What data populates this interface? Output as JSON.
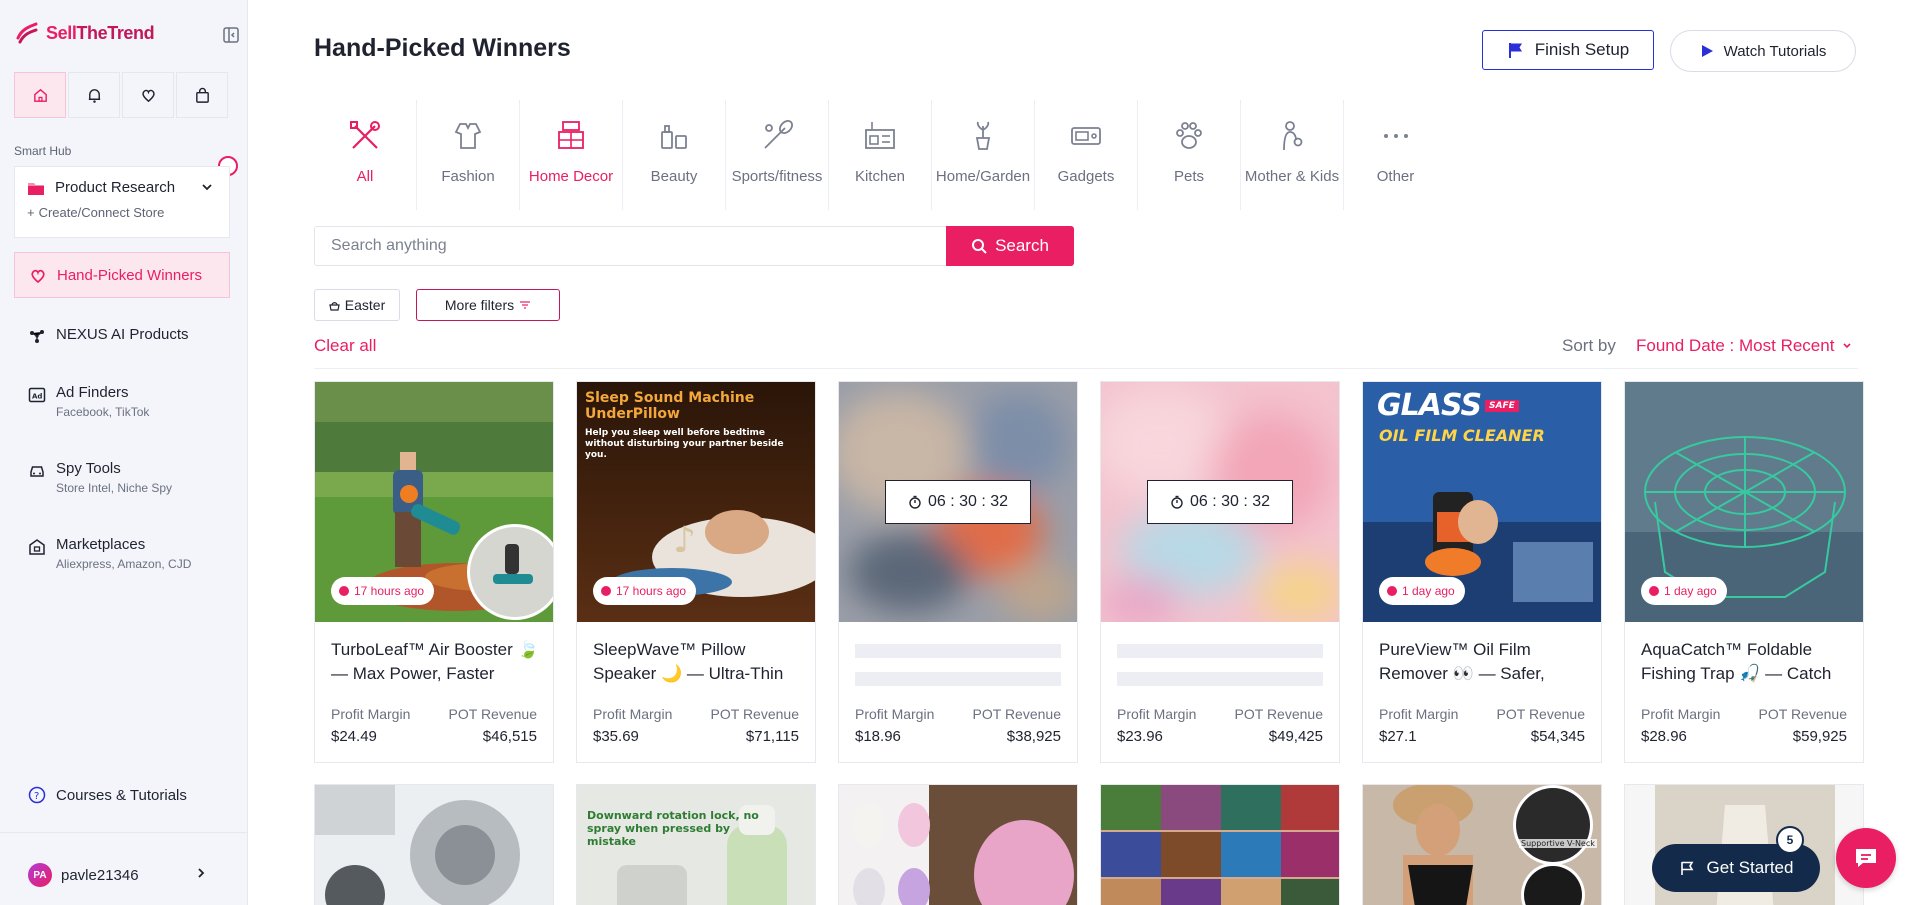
{
  "brand": {
    "name_part1": "Sell",
    "name_part2": "TheTrend",
    "accent": "#e91e63"
  },
  "sidebar": {
    "quick_icons": [
      "home-icon",
      "bell-icon",
      "heart-icon",
      "bag-icon"
    ],
    "smart_hub_label": "Smart Hub",
    "research": {
      "label": "Product Research",
      "create_label": "Create/Connect Store"
    },
    "items": [
      {
        "label": "Hand-Picked Winners",
        "sub": "",
        "icon": "heart-hand-icon",
        "active": true
      },
      {
        "label": "NEXUS AI Products",
        "sub": "",
        "icon": "nodes-icon"
      },
      {
        "label": "Ad Finders",
        "sub": "Facebook, TikTok",
        "icon": "ad-icon"
      },
      {
        "label": "Spy Tools",
        "sub": "Store Intel, Niche Spy",
        "icon": "car-spy-icon"
      },
      {
        "label": "Marketplaces",
        "sub": "Aliexpress, Amazon, CJD",
        "icon": "store-icon"
      }
    ],
    "courses_label": "Courses & Tutorials",
    "user": {
      "initials": "PA",
      "name": "pavle21346"
    }
  },
  "header": {
    "title": "Hand-Picked Winners",
    "finish_setup_label": "Finish Setup",
    "watch_tutorials_label": "Watch Tutorials"
  },
  "categories": [
    {
      "label": "All",
      "icon": "tools-icon",
      "active": true
    },
    {
      "label": "Fashion",
      "icon": "fashion-icon"
    },
    {
      "label": "Home Decor",
      "icon": "home-decor-icon",
      "active": true
    },
    {
      "label": "Beauty",
      "icon": "beauty-icon"
    },
    {
      "label": "Sports/fitness",
      "icon": "sports-icon"
    },
    {
      "label": "Kitchen",
      "icon": "kitchen-icon"
    },
    {
      "label": "Home/Garden",
      "icon": "garden-icon"
    },
    {
      "label": "Gadgets",
      "icon": "gadgets-icon"
    },
    {
      "label": "Pets",
      "icon": "paw-icon"
    },
    {
      "label": "Mother & Kids",
      "icon": "mother-kids-icon"
    },
    {
      "label": "Other",
      "icon": "dots-icon"
    }
  ],
  "search": {
    "placeholder": "Search anything",
    "button_label": "Search"
  },
  "filters": {
    "easter_label": "Easter",
    "more_filters_label": "More filters",
    "clear_all_label": "Clear all"
  },
  "sort": {
    "label": "Sort by",
    "value": "Found Date : Most Recent"
  },
  "products": [
    {
      "title": "TurboLeaf™ Air Booster 🍃 — Max Power, Faster",
      "time": "17 hours ago",
      "profit_margin_label": "Profit Margin",
      "pot_revenue_label": "POT Revenue",
      "profit_margin": "$24.49",
      "pot_revenue": "$46,515",
      "locked": false
    },
    {
      "title": "SleepWave™ Pillow Speaker 🌙 — Ultra-Thin",
      "time": "17 hours ago",
      "profit_margin_label": "Profit Margin",
      "pot_revenue_label": "POT Revenue",
      "profit_margin": "$35.69",
      "pot_revenue": "$71,115",
      "locked": false,
      "image_text": {
        "headline": "Sleep Sound Machine UnderPillow",
        "body": "Help you sleep well before bedtime without disturbing your partner beside you."
      }
    },
    {
      "title": "",
      "countdown": "06 : 30 : 32",
      "profit_margin_label": "Profit Margin",
      "pot_revenue_label": "POT Revenue",
      "profit_margin": "$18.96",
      "pot_revenue": "$38,925",
      "locked": true
    },
    {
      "title": "",
      "countdown": "06 : 30 : 32",
      "profit_margin_label": "Profit Margin",
      "pot_revenue_label": "POT Revenue",
      "profit_margin": "$23.96",
      "pot_revenue": "$49,425",
      "locked": true
    },
    {
      "title": "PureView™ Oil Film Remover 👀 — Safer,",
      "time": "1 day ago",
      "profit_margin_label": "Profit Margin",
      "pot_revenue_label": "POT Revenue",
      "profit_margin": "$27.1",
      "pot_revenue": "$54,345",
      "locked": false,
      "image_text": {
        "headline1": "GLASS",
        "headline2": "OIL FILM CLEANER",
        "tag": "SAFE"
      }
    },
    {
      "title": "AquaCatch™ Foldable Fishing Trap 🎣 — Catch",
      "time": "1 day ago",
      "profit_margin_label": "Profit Margin",
      "pot_revenue_label": "POT Revenue",
      "profit_margin": "$28.96",
      "pot_revenue": "$59,925",
      "locked": false
    }
  ],
  "products_row2_image_text": {
    "card2": "Downward rotation lock, no spray when pressed by mistake",
    "card5": "Supportive V-Neck"
  },
  "widget": {
    "get_started_label": "Get Started",
    "count": "5"
  }
}
